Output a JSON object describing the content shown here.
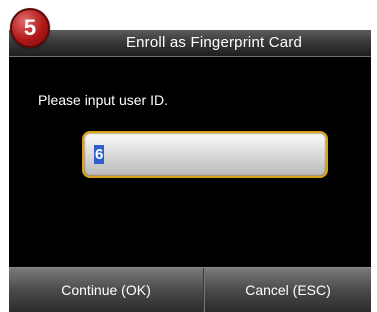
{
  "step_badge": {
    "number": "5",
    "color": "#b01818"
  },
  "dialog": {
    "title": "Enroll as Fingerprint Card",
    "prompt": "Please input user ID.",
    "user_id_value": "6"
  },
  "buttons": {
    "ok_label": "Continue (OK)",
    "esc_label": "Cancel (ESC)"
  },
  "colors": {
    "screen_bg": "#000000",
    "input_border": "#d9a21a",
    "selection": "#2f5fcf"
  }
}
